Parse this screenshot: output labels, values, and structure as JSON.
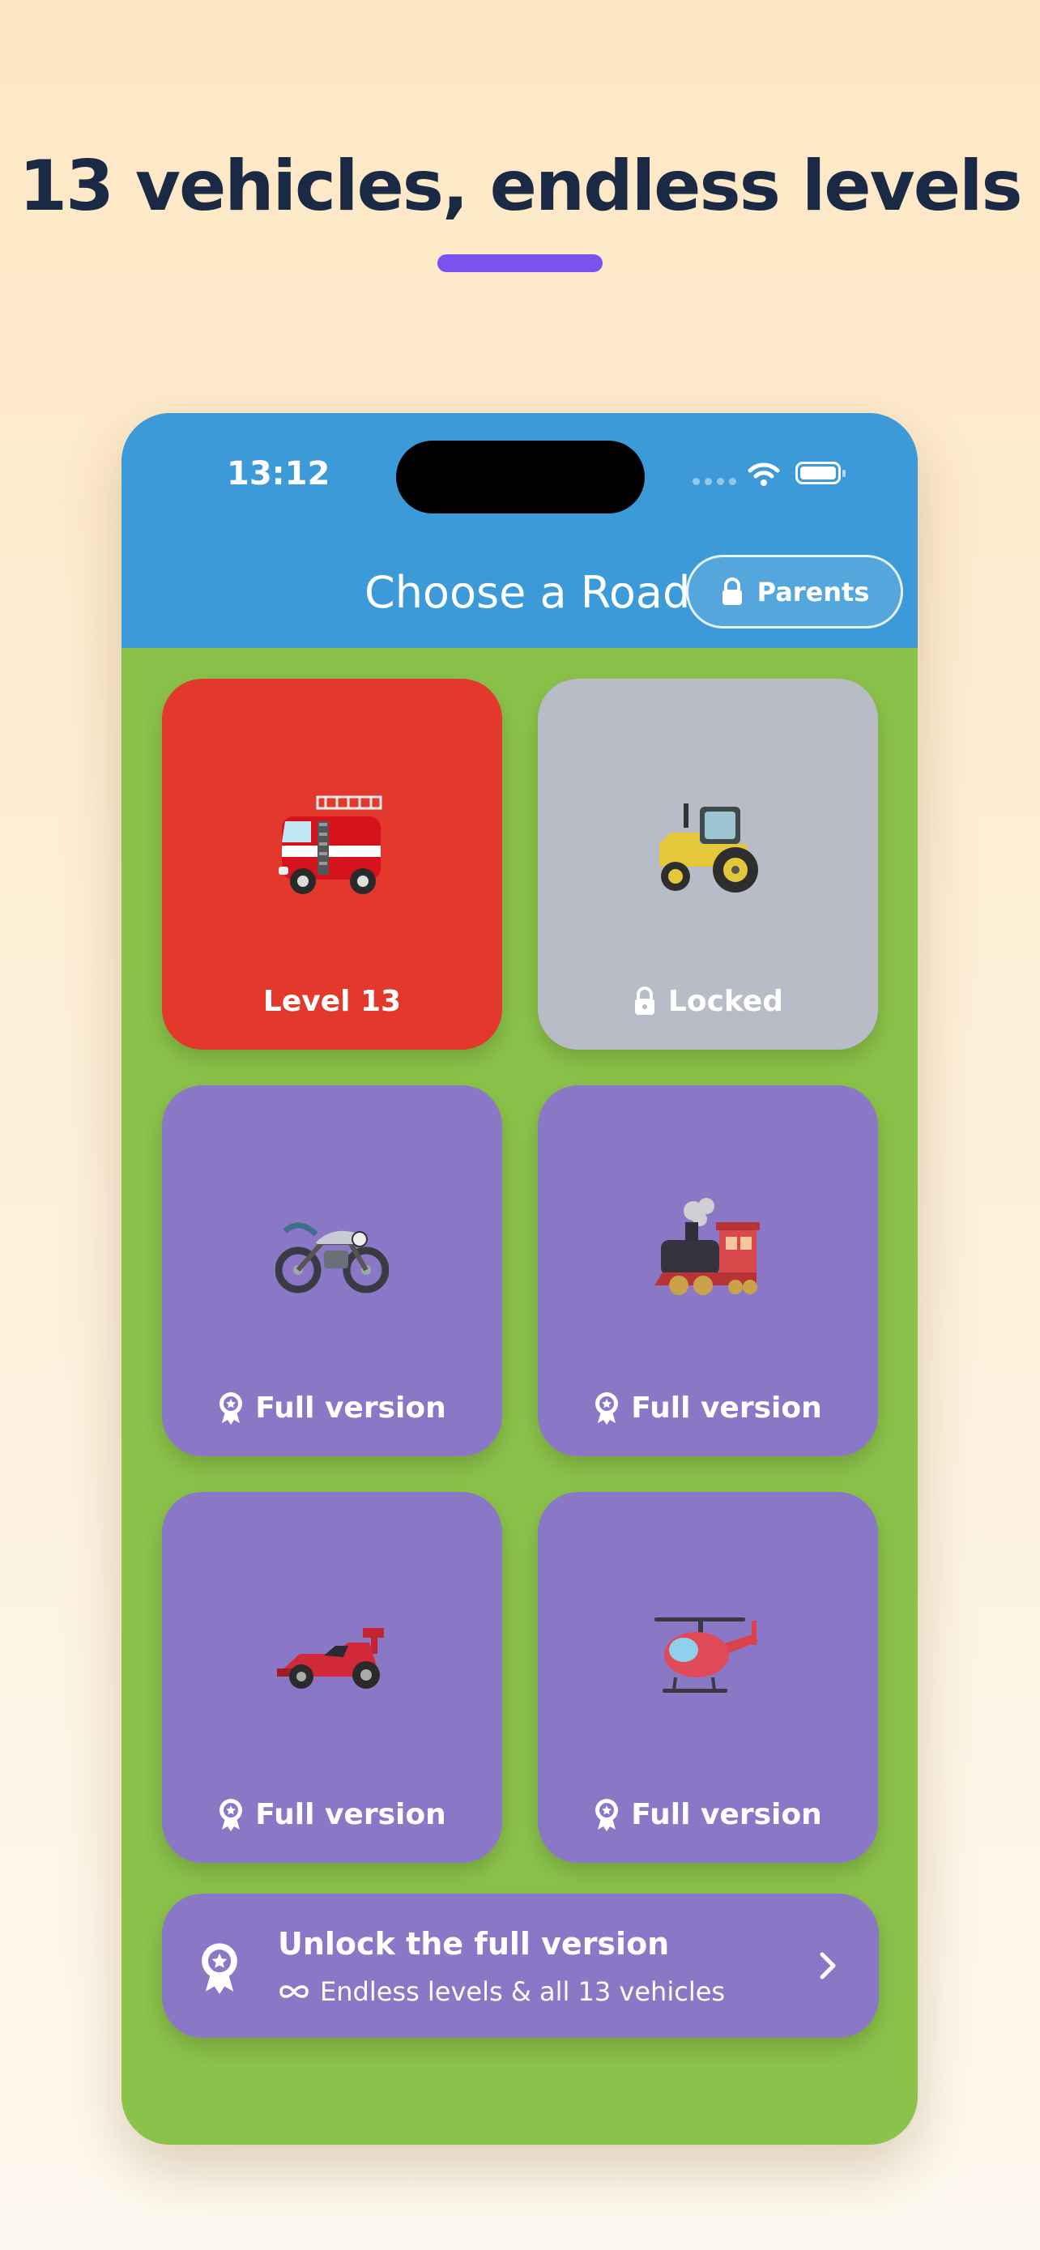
{
  "headline": {
    "title": "13 vehicles, endless levels",
    "accent_color": "#7b52ee"
  },
  "status_bar": {
    "time": "13:12"
  },
  "nav": {
    "title": "Choose a Road",
    "parents_button_label": "Parents",
    "bar_color": "#3d9ad8"
  },
  "roads": [
    {
      "vehicle_icon": "fire-engine-icon",
      "label": "Level 13",
      "state": "unlocked",
      "color": "#e3392d"
    },
    {
      "vehicle_icon": "tractor-icon",
      "label": "Locked",
      "state": "locked",
      "color": "#b8bcc7"
    },
    {
      "vehicle_icon": "motorcycle-icon",
      "label": "Full version",
      "state": "premium",
      "color": "#8a78c6"
    },
    {
      "vehicle_icon": "steam-locomotive-icon",
      "label": "Full version",
      "state": "premium",
      "color": "#8a78c6"
    },
    {
      "vehicle_icon": "racing-car-icon",
      "label": "Full version",
      "state": "premium",
      "color": "#8a78c6"
    },
    {
      "vehicle_icon": "helicopter-icon",
      "label": "Full version",
      "state": "premium",
      "color": "#8a78c6"
    }
  ],
  "unlock_banner": {
    "title": "Unlock the full version",
    "subtitle": "Endless levels & all 13 vehicles"
  },
  "background_color": "#8bc24a"
}
